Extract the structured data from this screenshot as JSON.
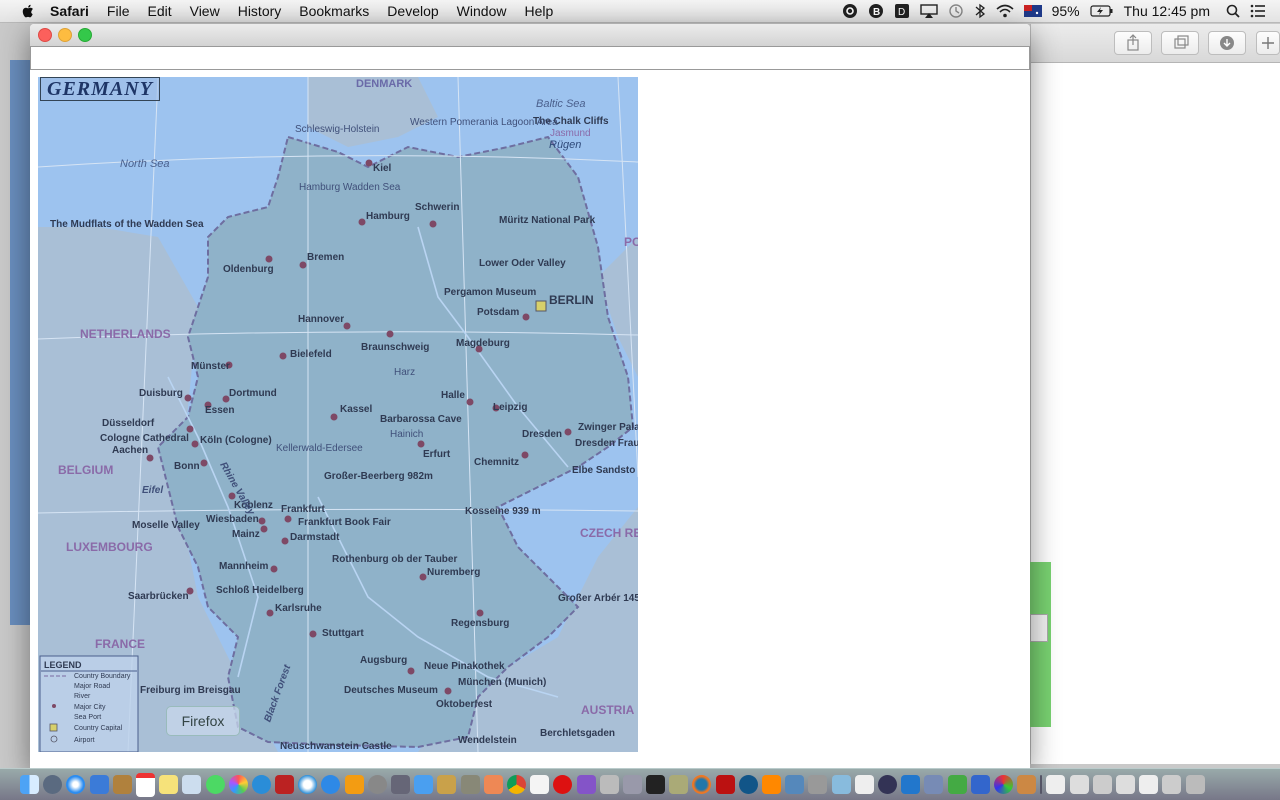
{
  "menubar": {
    "app": "Safari",
    "items": [
      "File",
      "Edit",
      "View",
      "History",
      "Bookmarks",
      "Develop",
      "Window",
      "Help"
    ],
    "battery": "95%",
    "clock": "Thu 12:45 pm"
  },
  "map": {
    "title": "GERMANY",
    "labels": {
      "denmark": "DENMARK",
      "baltic": "Baltic Sea",
      "north_sea": "North Sea",
      "netherlands": "NETHERLANDS",
      "belgium": "BELGIUM",
      "luxembourg": "LUXEMBOURG",
      "france": "FRANCE",
      "czech": "CZECH REPUBLI",
      "austria": "AUSTRIA",
      "pol": "PO",
      "berlin": "BERLIN",
      "hamburg": "Hamburg",
      "kiel": "Kiel",
      "schwerin": "Schwerin",
      "bremen": "Bremen",
      "oldenburg": "Oldenburg",
      "hannover": "Hannover",
      "potsdam": "Potsdam",
      "magdeburg": "Magdeburg",
      "braunschweig": "Braunschweig",
      "bielefeld": "Bielefeld",
      "munster": "Münster",
      "dortmund": "Dortmund",
      "duisburg": "Duisburg",
      "essen": "Essen",
      "dusseldorf": "Düsseldorf",
      "koln": "Köln (Cologne)",
      "aachen": "Aachen",
      "bonn": "Bonn",
      "kassel": "Kassel",
      "halle": "Halle",
      "leipzig": "Leipzig",
      "dresden": "Dresden",
      "erfurt": "Erfurt",
      "chemnitz": "Chemnitz",
      "koblenz": "Koblenz",
      "wiesbaden": "Wiesbaden",
      "mainz": "Mainz",
      "frankfurt": "Frankfurt",
      "darmstadt": "Darmstadt",
      "mannheim": "Mannheim",
      "saarbrucken": "Saarbrücken",
      "karlsruhe": "Karlsruhe",
      "stuttgart": "Stuttgart",
      "nuremberg": "Nuremberg",
      "regensburg": "Regensburg",
      "augsburg": "Augsburg",
      "munchen": "München (Munich)",
      "freiburg": "Freiburg im Breisgau",
      "mudflats": "The Mudflats of the Wadden Sea",
      "cologne_cath": "Cologne Cathedral",
      "moselle": "Moselle Valley",
      "heidelberg": "Schloß Heidelberg",
      "rothenburg": "Rothenburg ob der Tauber",
      "pinakothek": "Neue Pinakothek",
      "deutsches": "Deutsches Museum",
      "oktoberfest": "Oktoberfest",
      "neuschwanstein": "Neuschwanstein Castle",
      "wendelstein": "Wendelstein",
      "berchtesgaden": "Berchletsgaden",
      "pergamon": "Pergamon Museum",
      "muritz": "Müritz National Park",
      "lower_oder": "Lower Oder Valley",
      "chalk": "The Chalk Cliffs",
      "jasmund": "Jasmund",
      "rugen": "Rügen",
      "western_pom": "Western Pomerania Lagoon Area",
      "schleswig": "Schleswig-Holstein",
      "hamburg_wadden": "Hamburg Wadden Sea",
      "barbarossa": "Barbarossa Cave",
      "hainich": "Hainich",
      "kellerwald": "Kellerwald-Edersee",
      "harz": "Harz",
      "zwinger": "Zwinger Pala",
      "dresden_frau": "Dresden Frau",
      "elbe_sand": "Elbe Sandsto",
      "beerberg": "Großer-Beerberg 982m",
      "kosseine": "Kosseine 939 m",
      "arber": "Großer Arbér 1456 m",
      "frankfurt_book": "Frankfurt Book Fair",
      "black_forest": "Black Forest",
      "eifel": "Eifel",
      "rhine_valley": "Rhine Valley"
    },
    "legend": {
      "title": "LEGEND",
      "items": [
        "Country Boundary",
        "Major Road",
        "River",
        "Major City",
        "Sea Port",
        "Country Capital",
        "Airport"
      ]
    },
    "firefox_tip": "Firefox"
  },
  "colors": {
    "sea": "#9dc3ef",
    "land": "#a9bfd6",
    "germany": "#8fb2c9",
    "city": "#7e4966"
  }
}
